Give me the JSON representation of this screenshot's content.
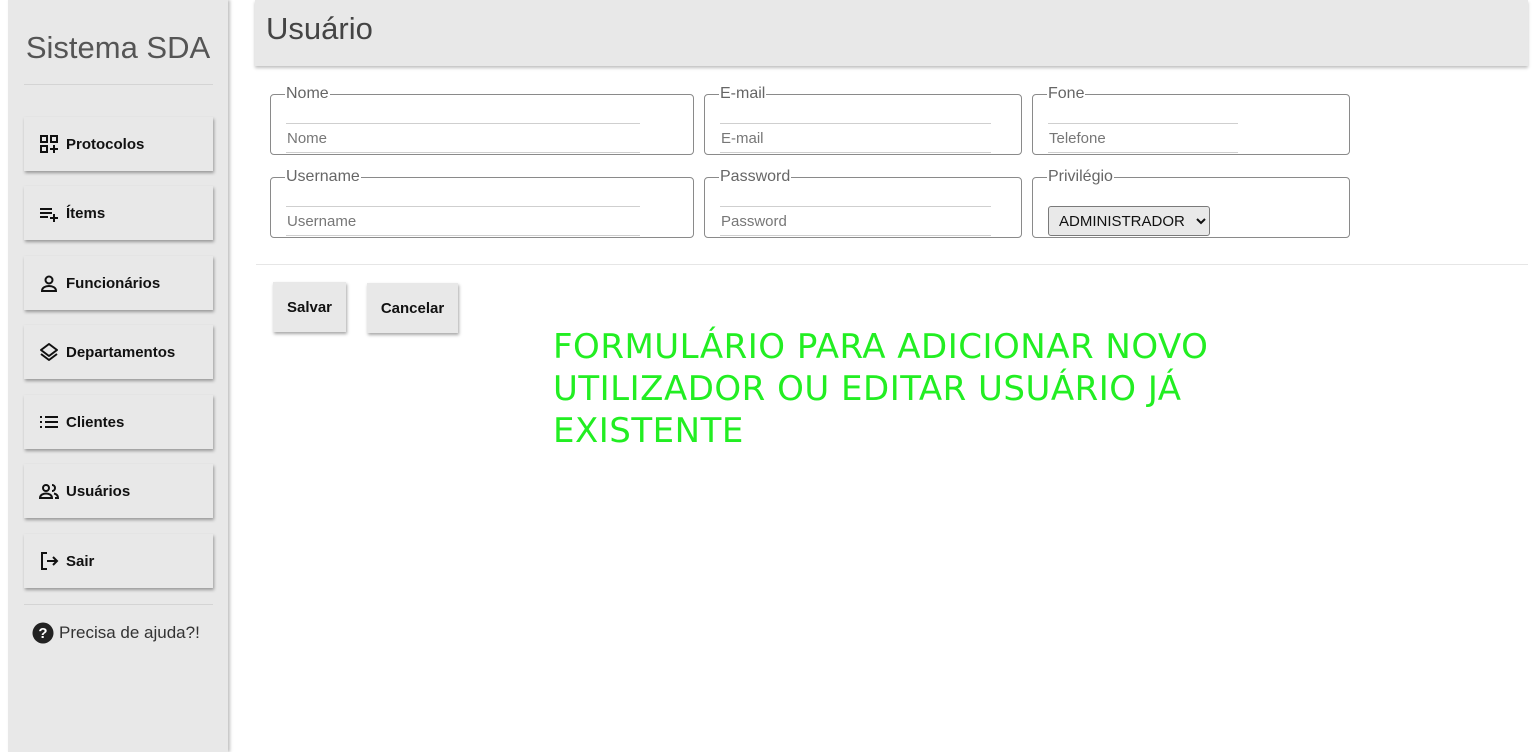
{
  "sidebar": {
    "brand": "Sistema SDA",
    "items": [
      {
        "label": "Protocolos",
        "icon": "grid-add-icon"
      },
      {
        "label": "Ítems",
        "icon": "playlist-add-icon"
      },
      {
        "label": "Funcionários",
        "icon": "person-icon"
      },
      {
        "label": "Departamentos",
        "icon": "layers-icon"
      },
      {
        "label": "Clientes",
        "icon": "list-icon"
      },
      {
        "label": "Usuários",
        "icon": "people-icon"
      },
      {
        "label": "Sair",
        "icon": "logout-icon"
      }
    ],
    "help": {
      "label": "Precisa de ajuda?!",
      "icon": "help-circle-icon"
    }
  },
  "header": {
    "title": "Usuário"
  },
  "form": {
    "nome": {
      "legend": "Nome",
      "placeholder": "Nome",
      "value": ""
    },
    "email": {
      "legend": "E-mail",
      "placeholder": "E-mail",
      "value": ""
    },
    "fone": {
      "legend": "Fone",
      "placeholder": "Telefone",
      "value": ""
    },
    "username": {
      "legend": "Username",
      "placeholder": "Username",
      "value": ""
    },
    "password": {
      "legend": "Password",
      "placeholder": "Password",
      "value": ""
    },
    "privilegio": {
      "legend": "Privilégio",
      "selected": "ADMINISTRADOR"
    },
    "save_label": "Salvar",
    "cancel_label": "Cancelar"
  },
  "annotation": "FORMULÁRIO PARA ADICIONAR NOVO UTILIZADOR OU EDITAR USUÁRIO JÁ EXISTENTE",
  "colors": {
    "sidebar_bg": "#e8e8e8",
    "annotation": "#22ee22"
  }
}
